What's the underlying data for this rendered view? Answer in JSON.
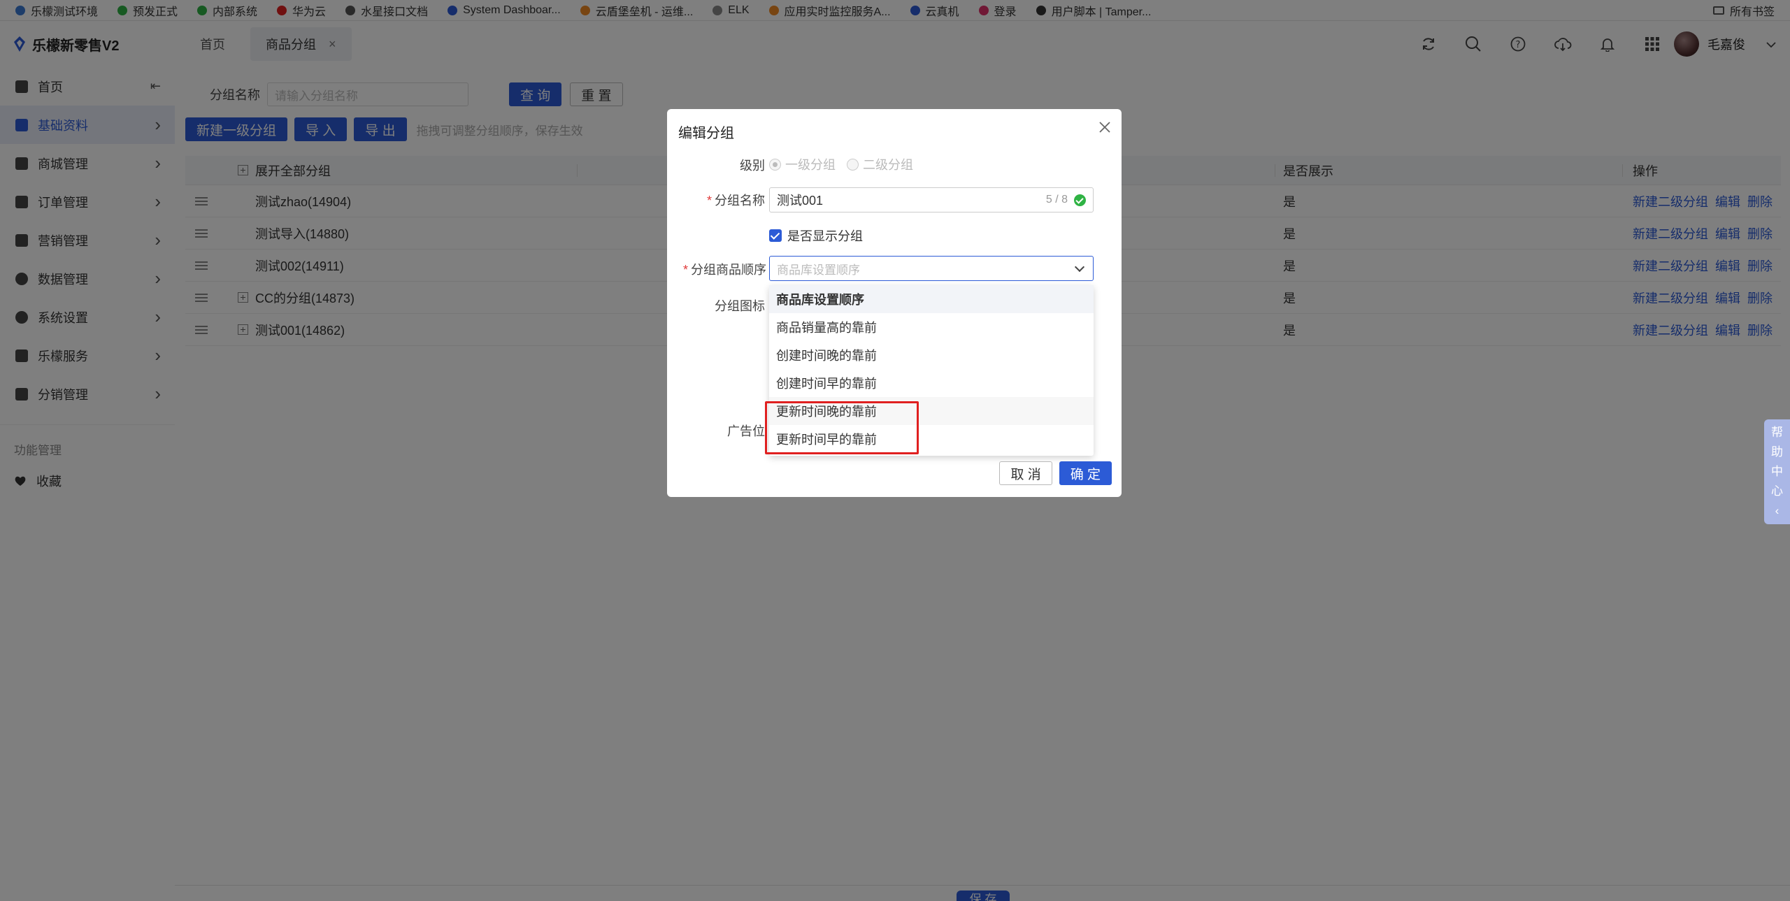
{
  "bookmarks": [
    {
      "label": "乐檬测试环境",
      "color": "#3a7bd5"
    },
    {
      "label": "预发正式",
      "color": "#2fb344"
    },
    {
      "label": "内部系统",
      "color": "#2fb344"
    },
    {
      "label": "华为云",
      "color": "#e02020"
    },
    {
      "label": "水星接口文档",
      "color": "#555555"
    },
    {
      "label": "System Dashboar...",
      "color": "#2c5bd6"
    },
    {
      "label": "云盾堡垒机 - 运维...",
      "color": "#f08a24"
    },
    {
      "label": "ELK",
      "color": "#888888"
    },
    {
      "label": "应用实时监控服务A...",
      "color": "#f08a24"
    },
    {
      "label": "云真机",
      "color": "#2c5bd6"
    },
    {
      "label": "登录",
      "color": "#e0306a"
    },
    {
      "label": "用户脚本 | Tamper...",
      "color": "#333333"
    }
  ],
  "bookmarks_all": "所有书签",
  "app": {
    "title": "乐檬新零售V2"
  },
  "sidebar": {
    "items": [
      {
        "label": "首页",
        "icon": "home-icon",
        "trail": "collapse"
      },
      {
        "label": "基础资料",
        "icon": "cube-icon",
        "trail": "chevron",
        "active": true
      },
      {
        "label": "商城管理",
        "icon": "store-icon",
        "trail": "chevron"
      },
      {
        "label": "订单管理",
        "icon": "order-icon",
        "trail": "chevron"
      },
      {
        "label": "营销管理",
        "icon": "chart-icon",
        "trail": "chevron"
      },
      {
        "label": "数据管理",
        "icon": "pie-icon",
        "trail": "chevron"
      },
      {
        "label": "系统设置",
        "icon": "settings-icon",
        "trail": "chevron"
      },
      {
        "label": "乐檬服务",
        "icon": "service-icon",
        "trail": "chevron"
      },
      {
        "label": "分销管理",
        "icon": "box-icon",
        "trail": "chevron"
      }
    ],
    "section_label": "功能管理",
    "favorites_label": "收藏"
  },
  "tabs": [
    {
      "label": "首页"
    },
    {
      "label": "商品分组",
      "active": true
    }
  ],
  "user": {
    "name": "毛嘉俊"
  },
  "search": {
    "label": "分组名称",
    "placeholder": "请输入分组名称",
    "query": "查 询",
    "reset": "重 置"
  },
  "actions": {
    "new_group": "新建一级分组",
    "import": "导 入",
    "export": "导 出",
    "hint": "拖拽可调整分组顺序，保存生效"
  },
  "table": {
    "headers": {
      "name": "展开全部分组",
      "show": "是否展示",
      "ops": "操作"
    },
    "rows": [
      {
        "name": "测试zhao(14904)",
        "show": "是",
        "expandable": false
      },
      {
        "name": "测试导入(14880)",
        "show": "是",
        "expandable": false
      },
      {
        "name": "测试002(14911)",
        "show": "是",
        "expandable": false
      },
      {
        "name": "CC的分组(14873)",
        "show": "是",
        "expandable": true
      },
      {
        "name": "测试001(14862)",
        "show": "是",
        "expandable": true
      }
    ],
    "ops": {
      "add_sub": "新建二级分组",
      "edit": "编辑",
      "delete": "删除"
    }
  },
  "footer": {
    "save": "保 存"
  },
  "help": [
    "帮",
    "助",
    "中",
    "心",
    "‹"
  ],
  "modal": {
    "title": "编辑分组",
    "level_label": "级别",
    "level_options": [
      "一级分组",
      "二级分组"
    ],
    "name_label": "分组名称",
    "name_value": "测试001",
    "name_count": "5 / 8",
    "show_checkbox": "是否显示分组",
    "order_label": "分组商品顺序",
    "order_placeholder": "商品库设置顺序",
    "icon_label": "分组图标",
    "ad_label": "广告位",
    "options": [
      "商品库设置顺序",
      "商品销量高的靠前",
      "创建时间晚的靠前",
      "创建时间早的靠前",
      "更新时间晚的靠前",
      "更新时间早的靠前"
    ],
    "cancel": "取 消",
    "confirm": "确 定"
  },
  "colors": {
    "primary": "#2c5bd6",
    "danger": "#e02020",
    "success": "#2fb344"
  }
}
